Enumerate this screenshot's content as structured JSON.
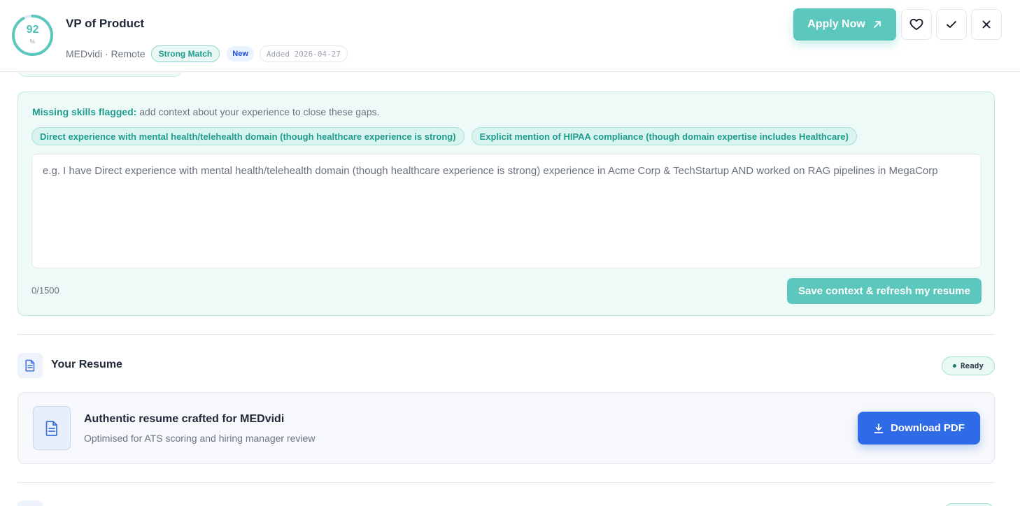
{
  "header": {
    "score": "92",
    "score_unit": "%",
    "score_fraction": 0.92,
    "title": "VP of Product",
    "company": "MEDvidi · Remote",
    "match_badge": "Strong Match",
    "new_badge": "New",
    "added": "Added 2026-04-27",
    "apply_label": "Apply Now",
    "icons": [
      "heart-icon",
      "check-icon",
      "close-icon"
    ]
  },
  "missing_skills": {
    "intro_bold": "Missing skills flagged:",
    "intro_rest": " add context about your experience to close these gaps.",
    "gaps": [
      "Direct experience with mental health/telehealth domain (though healthcare experience is strong)",
      "Explicit mention of HIPAA compliance (though domain expertise includes Healthcare)"
    ],
    "placeholder": "e.g. I have Direct experience with mental health/telehealth domain (though healthcare experience is strong) experience in Acme Corp & TechStartup AND worked on RAG pipelines in MegaCorp",
    "value": "",
    "counter": "0/1500",
    "save_label": "Save context & refresh my resume"
  },
  "resume": {
    "section_title": "Your Resume",
    "status": "Ready",
    "card_title": "Authentic resume crafted for MEDvidi",
    "card_subtitle": "Optimised for ATS scoring and hiring manager review",
    "download_label": "Download PDF"
  },
  "colors": {
    "accent_teal": "#5cc8bd",
    "teal_text": "#1f9c8e",
    "blue_primary": "#2f6be6",
    "new_blue": "#1d4ed8"
  }
}
